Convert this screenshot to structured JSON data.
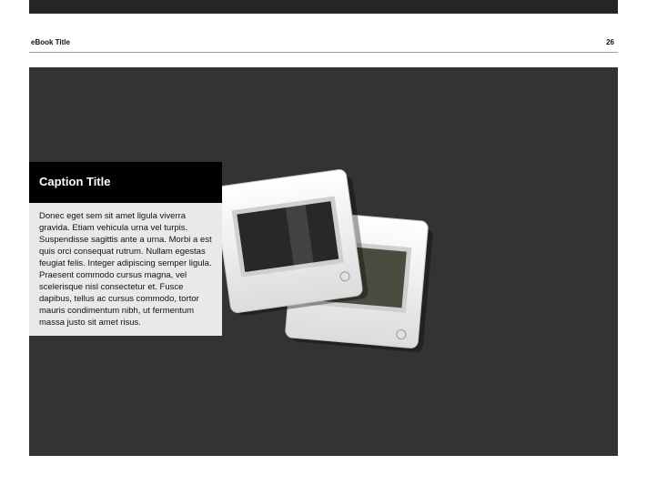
{
  "header": {
    "book_title": "eBook Title",
    "page_number": "26"
  },
  "caption": {
    "title": "Caption Title",
    "body": "Donec eget sem sit amet ligula viverra gravida. Etiam vehicula urna vel turpis. Suspendisse sagittis ante a urna. Morbi a est quis orci consequat rutrum. Nullam egestas feugiat felis. Integer adipiscing semper ligula. Praesent commodo cursus magna, vel scelerisque nisl consectetur et. Fusce dapibus, tellus ac cursus commodo, tortor mauris condimentum nibh, ut fermentum massa justo sit amet risus."
  },
  "colors": {
    "stage": "#333333",
    "caption_header": "#000000",
    "caption_body": "#e9e9e9"
  },
  "image": {
    "icon": "photo-slides-icon"
  }
}
